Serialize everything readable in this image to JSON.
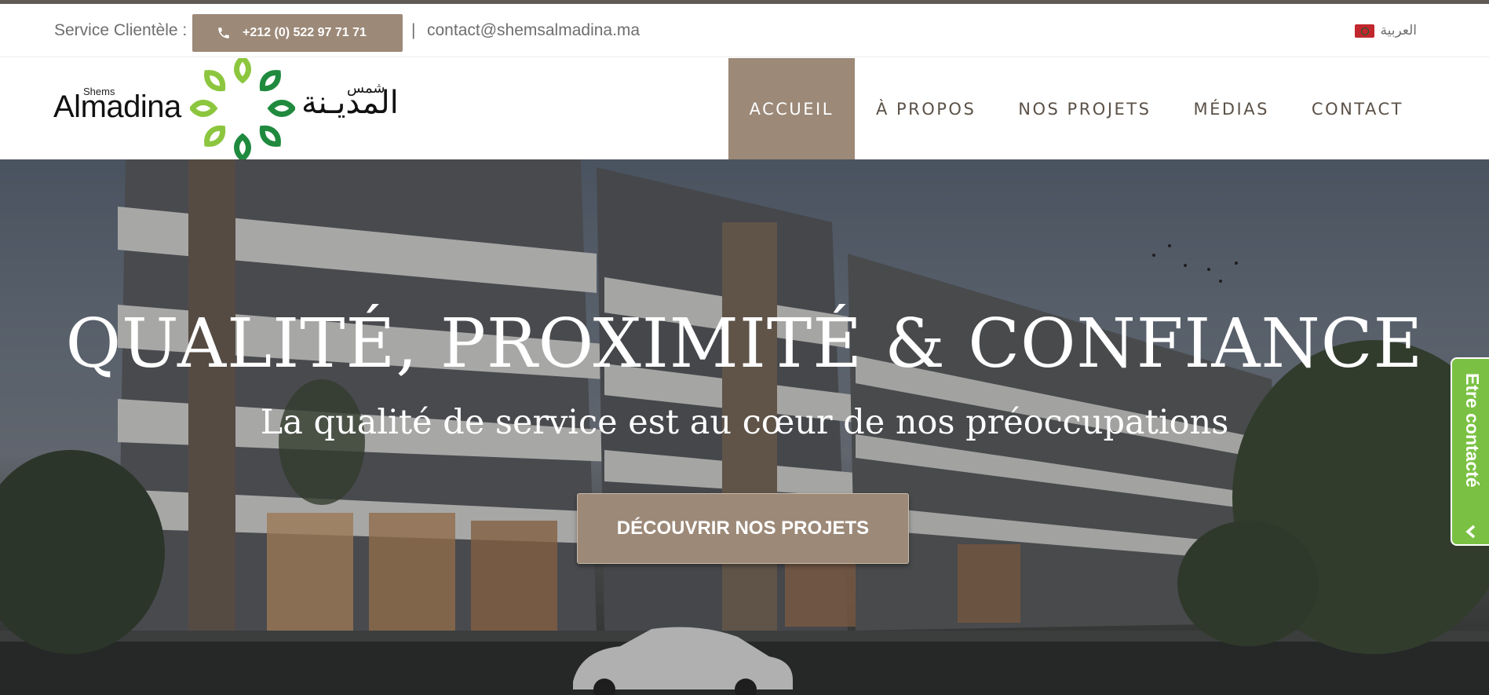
{
  "topbar": {
    "service_label": "Service Clientèle :",
    "phone": "+212 (0) 522 97 71 71",
    "separator": "|",
    "email": "contact@shemsalmadina.ma",
    "language": "العربية"
  },
  "logo": {
    "small": "Shems",
    "latin": "Almadina",
    "arabic_small": "شمس",
    "arabic": "المديـنة"
  },
  "nav": {
    "items": [
      {
        "label": "ACCUEIL",
        "active": true
      },
      {
        "label": "À PROPOS",
        "active": false
      },
      {
        "label": "NOS PROJETS",
        "active": false
      },
      {
        "label": "MÉDIAS",
        "active": false
      },
      {
        "label": "CONTACT",
        "active": false
      }
    ]
  },
  "hero": {
    "title": "QUALITÉ, PROXIMITÉ & CONFIANCE",
    "subtitle": "La qualité de service est au cœur de nos préoccupations",
    "cta": "DÉCOUVRIR NOS PROJETS"
  },
  "side_tab": {
    "label": "Etre contacté"
  },
  "colors": {
    "accent": "#9c8978",
    "side_tab": "#7ac143",
    "logo_green_dark": "#1f8a3e",
    "logo_green_light": "#8cc63f"
  }
}
